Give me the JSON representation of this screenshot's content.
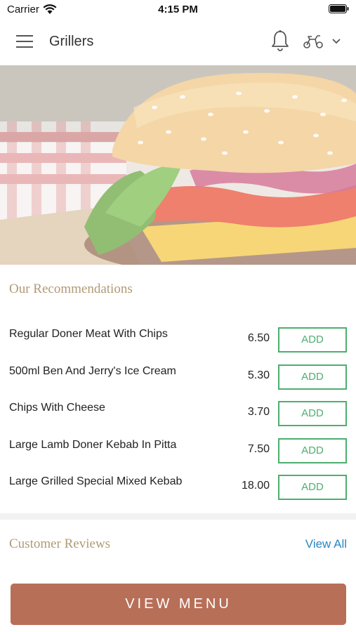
{
  "status": {
    "carrier": "Carrier",
    "time": "4:15 PM"
  },
  "header": {
    "title": "Grillers"
  },
  "hero": {
    "image": "burger-photo"
  },
  "recommendations": {
    "title": "Our Recommendations",
    "items": [
      {
        "name": "Regular Doner Meat With Chips",
        "price": "6.50",
        "button": "ADD"
      },
      {
        "name": "500ml Ben And Jerry's Ice Cream",
        "price": "5.30",
        "button": "ADD"
      },
      {
        "name": "Chips With Cheese",
        "price": "3.70",
        "button": "ADD"
      },
      {
        "name": "Large Lamb Doner Kebab In Pitta",
        "price": "7.50",
        "button": "ADD"
      },
      {
        "name": "Large Grilled Special Mixed Kebab",
        "price": "18.00",
        "button": "ADD"
      }
    ]
  },
  "reviews": {
    "title": "Customer Reviews",
    "view_all": "View All"
  },
  "footer": {
    "view_menu": "VIEW MENU"
  },
  "colors": {
    "accent_gold": "#b09a75",
    "add_green": "#4caf6e",
    "link_blue": "#2a86c4",
    "menu_button": "#b86f58"
  }
}
